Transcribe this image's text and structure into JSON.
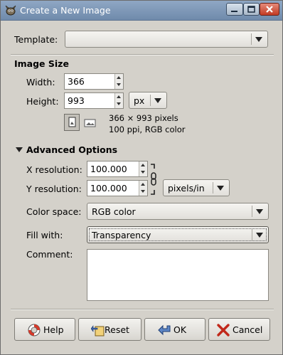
{
  "window": {
    "title": "Create a New Image"
  },
  "template": {
    "label": "Template:",
    "value": ""
  },
  "image_size": {
    "heading": "Image Size",
    "width_label": "Width:",
    "width_value": "366",
    "height_label": "Height:",
    "height_value": "993",
    "unit": "px",
    "info_line1": "366 × 993 pixels",
    "info_line2": "100 ppi, RGB color"
  },
  "advanced": {
    "heading": "Advanced Options",
    "xres_label": "X resolution:",
    "xres_value": "100.000",
    "yres_label": "Y resolution:",
    "yres_value": "100.000",
    "res_unit": "pixels/in",
    "colorspace_label": "Color space:",
    "colorspace_value": "RGB color",
    "fill_label": "Fill with:",
    "fill_value": "Transparency",
    "comment_label": "Comment:",
    "comment_value": ""
  },
  "buttons": {
    "help": "Help",
    "reset": "Reset",
    "ok": "OK",
    "cancel": "Cancel"
  }
}
